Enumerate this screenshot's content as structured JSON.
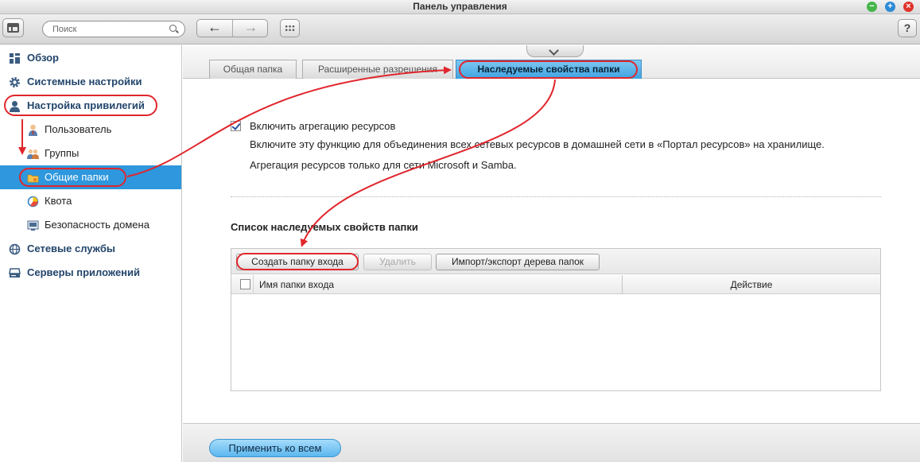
{
  "window": {
    "title": "Панель управления"
  },
  "toolbar": {
    "search_placeholder": "Поиск",
    "back_glyph": "←",
    "forward_glyph": "→",
    "help_label": "?"
  },
  "sidebar": {
    "items": [
      {
        "label": "Обзор",
        "icon": "overview-icon",
        "level": "top"
      },
      {
        "label": "Системные настройки",
        "icon": "gear-icon",
        "level": "top"
      },
      {
        "label": "Настройка привилегий",
        "icon": "user-icon",
        "level": "top"
      },
      {
        "label": "Пользователь",
        "icon": "user-icon",
        "level": "sub"
      },
      {
        "label": "Группы",
        "icon": "group-icon",
        "level": "sub"
      },
      {
        "label": "Общие папки",
        "icon": "folder-icon",
        "level": "sub",
        "active": true
      },
      {
        "label": "Квота",
        "icon": "quota-icon",
        "level": "sub"
      },
      {
        "label": "Безопасность домена",
        "icon": "domain-icon",
        "level": "sub"
      },
      {
        "label": "Сетевые службы",
        "icon": "globe-icon",
        "level": "top"
      },
      {
        "label": "Серверы приложений",
        "icon": "server-icon",
        "level": "top"
      }
    ]
  },
  "tabs": [
    {
      "label": "Общая папка"
    },
    {
      "label": "Расширенные разрешения"
    },
    {
      "label": "Наследуемые свойства папки",
      "active": true
    }
  ],
  "main": {
    "aggregation": {
      "checked": true,
      "label": "Включить агрегацию ресурсов",
      "description1": "Включите эту функцию для объединения всех сетевых ресурсов в домашней сети в «Портал ресурсов» на хранилище.",
      "description2": "Агрегация ресурсов только для сети Microsoft и Samba."
    },
    "section_title": "Список наследуемых свойств папки",
    "grid": {
      "buttons": {
        "create": "Создать папку входа",
        "delete": "Удалить",
        "import": "Импорт/экспорт дерева папок"
      },
      "columns": [
        "Имя папки входа",
        "Действие"
      ],
      "rows": []
    }
  },
  "footer": {
    "apply_label": "Применить ко всем"
  },
  "colors": {
    "accent": "#2e97dd",
    "annotation": "#e0262c",
    "nav_top_text": "#22456b"
  }
}
